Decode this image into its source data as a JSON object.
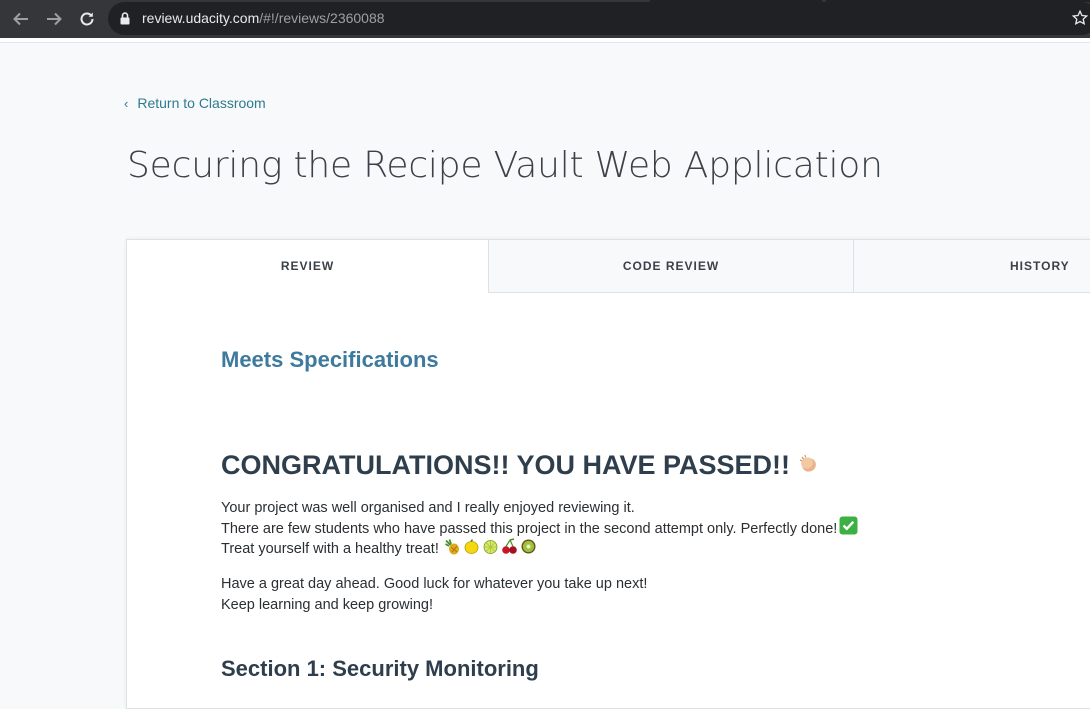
{
  "browser": {
    "url_host": "review.udacity.com",
    "url_path": "/#!/reviews/2360088",
    "icons": [
      "back-arrow-icon",
      "forward-arrow-icon",
      "reload-icon",
      "lock-icon",
      "star-icon"
    ]
  },
  "page": {
    "back_link": "Return to Classroom",
    "title": "Securing the Recipe Vault Web Application"
  },
  "tabs": [
    {
      "label": "REVIEW",
      "active": true
    },
    {
      "label": "CODE REVIEW",
      "active": false
    },
    {
      "label": "HISTORY",
      "active": false
    }
  ],
  "review": {
    "status": "Meets Specifications",
    "heading": "CONGRATULATIONS!! YOU HAVE PASSED!!",
    "lines_1": [
      "Your project was well organised and I really enjoyed reviewing it.",
      "There are few students who have passed this project in the second attempt only. Perfectly done!",
      "Treat yourself with a healthy treat!"
    ],
    "lines_2": [
      "Have a great day ahead. Good luck for whatever you take up next!",
      "Keep learning and keep growing!"
    ],
    "section_heading": "Section 1: Security Monitoring",
    "emoji": {
      "heading": "clapping-hands-icon",
      "done": "check-mark-icon",
      "treats": [
        "pineapple-icon",
        "lemon-icon",
        "lime-icon",
        "cherries-icon",
        "kiwi-icon"
      ]
    }
  },
  "colors": {
    "accent": "#2e7a8f",
    "status": "#3d7a9e",
    "heading": "#2f3e4c"
  }
}
